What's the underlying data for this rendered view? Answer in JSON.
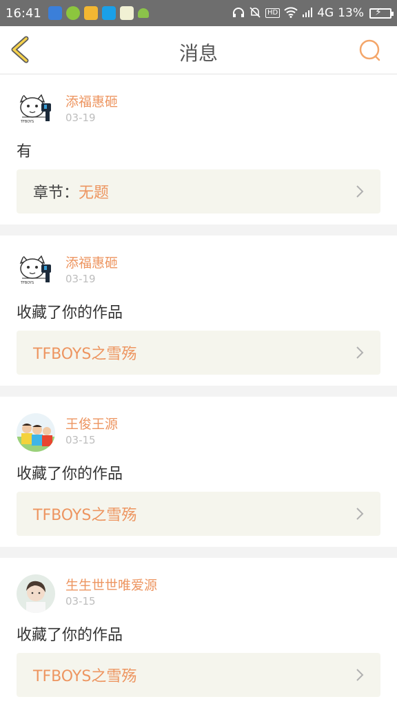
{
  "statusbar": {
    "time": "16:41",
    "network": "4G",
    "battery": "13%",
    "app_icon_colors": [
      "#3b7fd9",
      "#8cc63e",
      "#f2b732",
      "#1aa0e8",
      "#f1f1d4",
      "#8bc34a"
    ]
  },
  "nav": {
    "title": "消息",
    "back_icon": "chevron-left-icon",
    "search_icon": "search-icon",
    "accent": "#f6b24b"
  },
  "messages": [
    {
      "user": "添福惠砸",
      "date": "03-19",
      "text": "有",
      "ref_prefix": "章节：",
      "ref_title": "无题",
      "avatar": "cat-cartoon"
    },
    {
      "user": "添福惠砸",
      "date": "03-19",
      "text": "收藏了你的作品",
      "ref_prefix": "",
      "ref_title": "TFBOYS之雪殇",
      "avatar": "cat-cartoon"
    },
    {
      "user": "王俊王源",
      "date": "03-15",
      "text": "收藏了你的作品",
      "ref_prefix": "",
      "ref_title": "TFBOYS之雪殇",
      "avatar": "photo-group"
    },
    {
      "user": "生生世世唯爱源",
      "date": "03-15",
      "text": "收藏了你的作品",
      "ref_prefix": "",
      "ref_title": "TFBOYS之雪殇",
      "avatar": "photo-portrait"
    }
  ],
  "colors": {
    "accent_orange": "#ed9560",
    "ref_bg": "#f5f5ed",
    "separator": "#f3f3f3"
  }
}
